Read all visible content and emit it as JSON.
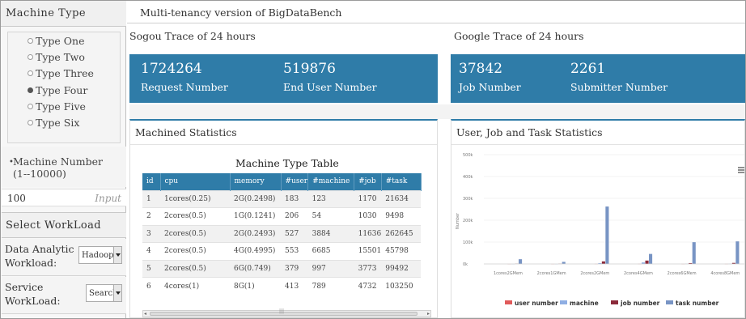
{
  "sidebar": {
    "title": "Machine Type",
    "types": [
      {
        "label": "Type One",
        "selected": false
      },
      {
        "label": "Type Two",
        "selected": false
      },
      {
        "label": "Type Three",
        "selected": false
      },
      {
        "label": "Type Four",
        "selected": true
      },
      {
        "label": "Type Five",
        "selected": false
      },
      {
        "label": "Type Six",
        "selected": false
      }
    ],
    "machine_number_label": "Machine Number",
    "machine_number_range": "(1--10000)",
    "number_value": "100",
    "number_placeholder": "Input",
    "select_workload_title": "Select WorkLoad",
    "data_analytic": {
      "line1": "Data Analytic",
      "line2": "Workload:",
      "value": "Hadoop"
    },
    "service": {
      "line1": "Service",
      "line2": "WorkLoad:",
      "value": "Search"
    }
  },
  "main": {
    "title": "Multi-tenancy version of BigDataBench",
    "sogou": {
      "title": "Sogou Trace of 24 hours",
      "stat1_value": "1724264",
      "stat1_label": "Request Number",
      "stat2_value": "519876",
      "stat2_label": "End User Number"
    },
    "google": {
      "title": "Google Trace of 24 hours",
      "stat1_value": "37842",
      "stat1_label": "Job Number",
      "stat2_value": "2261",
      "stat2_label": "Submitter Number"
    },
    "machined": {
      "title": "Machined Statistics",
      "table_title": "Machine Type Table",
      "columns": [
        "id",
        "cpu",
        "memory",
        "#user",
        "#machine",
        "#job",
        "#task"
      ],
      "rows": [
        [
          "1",
          "1cores(0.25)",
          "2G(0.2498)",
          "183",
          "123",
          "1170",
          "21634"
        ],
        [
          "2",
          "2cores(0.5)",
          "1G(0.1241)",
          "206",
          "54",
          "1030",
          "9498"
        ],
        [
          "3",
          "2cores(0.5)",
          "2G(0.2493)",
          "527",
          "3884",
          "11636",
          "262645"
        ],
        [
          "4",
          "2cores(0.5)",
          "4G(0.4995)",
          "553",
          "6685",
          "15501",
          "45798"
        ],
        [
          "5",
          "2cores(0.5)",
          "6G(0.749)",
          "379",
          "997",
          "3773",
          "99492"
        ],
        [
          "6",
          "4cores(1)",
          "8G(1)",
          "413",
          "789",
          "4732",
          "103250"
        ]
      ]
    },
    "chart_panel_title": "User, Job and Task Statistics",
    "menu_icon": "hamburger-icon"
  },
  "chart_data": {
    "type": "bar",
    "title": "",
    "ylabel": "Number",
    "ylim": [
      0,
      500000
    ],
    "yticks": [
      "0k",
      "100k",
      "200k",
      "300k",
      "400k",
      "500k"
    ],
    "categories": [
      "1cores2GMem",
      "2cores1GMem",
      "2cores2GMem",
      "2cores4GMem",
      "2cores6GMem",
      "4cores8GMem"
    ],
    "series": [
      {
        "name": "user number",
        "color": "#e05a5a",
        "values": [
          183,
          206,
          527,
          553,
          379,
          413
        ]
      },
      {
        "name": "machine",
        "color": "#8faee3",
        "values": [
          123,
          54,
          3884,
          6685,
          997,
          789
        ]
      },
      {
        "name": "job number",
        "color": "#8b2a3a",
        "values": [
          1170,
          1030,
          11636,
          15501,
          3773,
          4732
        ]
      },
      {
        "name": "task number",
        "color": "#7894c4",
        "values": [
          21634,
          9498,
          262645,
          45798,
          99492,
          103250
        ]
      }
    ],
    "legend_position": "bottom"
  }
}
